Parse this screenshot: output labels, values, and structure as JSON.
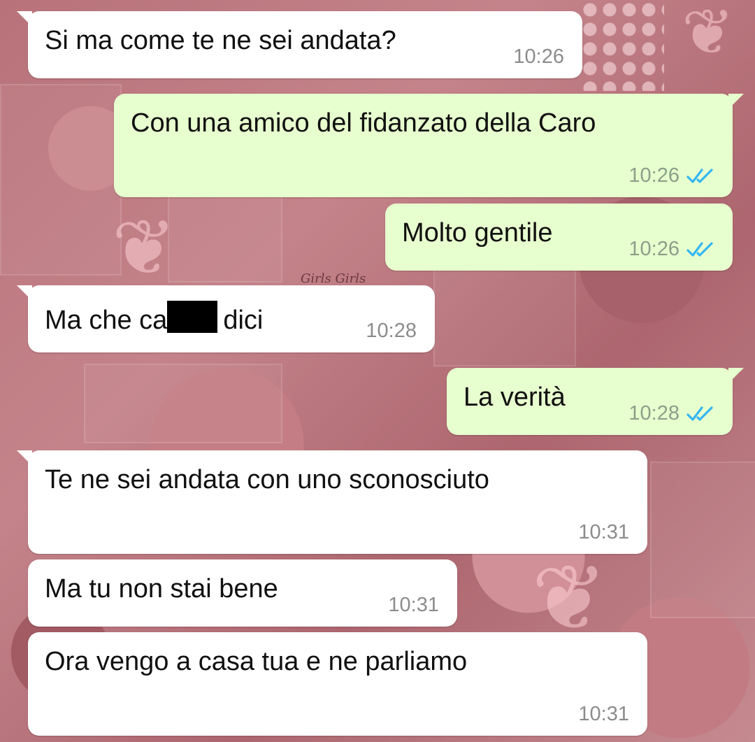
{
  "messages": [
    {
      "direction": "in",
      "text": "Si ma come te ne sei andata?",
      "time": "10:26"
    },
    {
      "direction": "out",
      "text": "Con una amico del fidanzato della Caro",
      "time": "10:26",
      "status": "read"
    },
    {
      "direction": "out",
      "text": "Molto gentile",
      "time": "10:26",
      "status": "read"
    },
    {
      "direction": "in",
      "text_before": "Ma che ca",
      "text_after": "dici",
      "redacted": true,
      "time": "10:28"
    },
    {
      "direction": "out",
      "text": "La verità",
      "time": "10:28",
      "status": "read"
    },
    {
      "direction": "in",
      "text": "Te ne sei andata con uno sconosciuto",
      "time": "10:31"
    },
    {
      "direction": "in",
      "text": "Ma tu non stai bene",
      "time": "10:31"
    },
    {
      "direction": "in",
      "text": "Ora vengo a casa tua e ne parliamo",
      "time": "10:31"
    }
  ],
  "wallpaper": {
    "text": "Girls Girls",
    "colors": {
      "base": "#b56f76",
      "incoming_bubble": "#ffffff",
      "outgoing_bubble": "#e7fece",
      "read_ticks": "#34b7f1"
    }
  },
  "icons": {
    "read_receipt": "double-check-icon",
    "decoration": "butterfly-icon"
  }
}
